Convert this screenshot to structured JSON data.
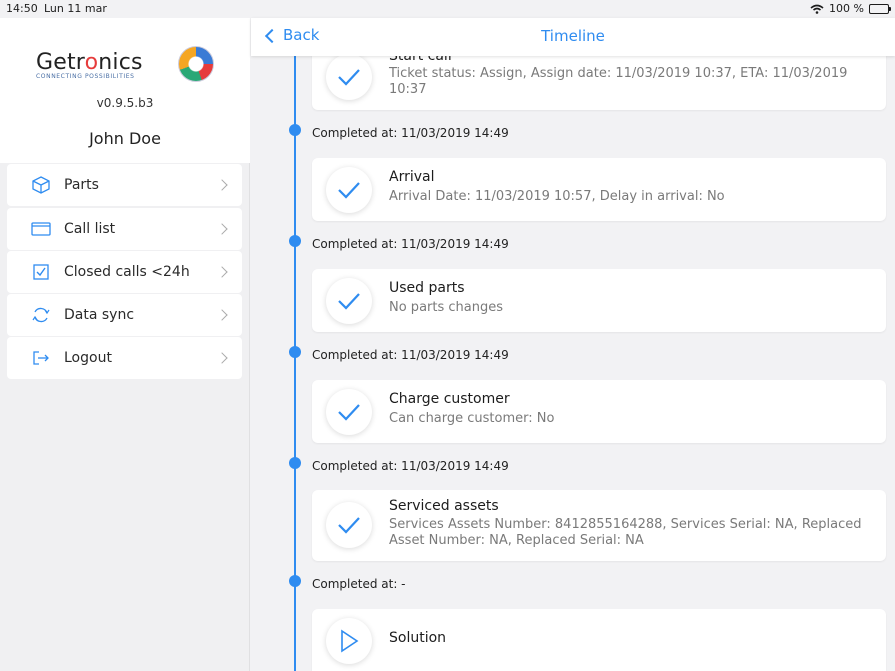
{
  "statusbar": {
    "time": "14:50",
    "date": "Lun 11 mar",
    "battery": "100 %"
  },
  "sidebar": {
    "logo_text_a": "Getr",
    "logo_text_o": "o",
    "logo_text_b": "nics",
    "logo_tagline": "CONNECTING POSSIBILITIES",
    "version": "v0.9.5.b3",
    "username": "John Doe",
    "items": [
      {
        "label": "Parts",
        "icon": "box-icon"
      },
      {
        "label": "Call list",
        "icon": "folder-icon"
      },
      {
        "label": "Closed calls <24h",
        "icon": "checkbox-icon"
      },
      {
        "label": "Data sync",
        "icon": "sync-icon"
      },
      {
        "label": "Logout",
        "icon": "logout-icon"
      }
    ]
  },
  "nav": {
    "back_label": "Back",
    "title": "Timeline"
  },
  "colors": {
    "accent": "#2f8cf0"
  },
  "timeline": {
    "entries": [
      {
        "title": "Start call",
        "desc": "Ticket status: Assign, Assign date: 11/03/2019 10:37, ETA: 11/03/2019 10:37",
        "status": "done",
        "completed": "Completed at: 11/03/2019 14:49"
      },
      {
        "title": "Arrival",
        "desc": "Arrival Date: 11/03/2019 10:57, Delay in arrival: No",
        "status": "done",
        "completed": "Completed at: 11/03/2019 14:49"
      },
      {
        "title": "Used parts",
        "desc": "No parts changes",
        "status": "done",
        "completed": "Completed at: 11/03/2019 14:49"
      },
      {
        "title": "Charge customer",
        "desc": "Can charge customer: No",
        "status": "done",
        "completed": "Completed at: 11/03/2019 14:49"
      },
      {
        "title": "Serviced assets",
        "desc": "Services Assets Number: 8412855164288, Services Serial: NA, Replaced Asset Number: NA, Replaced Serial: NA",
        "status": "done",
        "completed": "Completed at: -"
      },
      {
        "title": "Solution",
        "desc": "",
        "status": "pending",
        "completed": ""
      }
    ]
  }
}
